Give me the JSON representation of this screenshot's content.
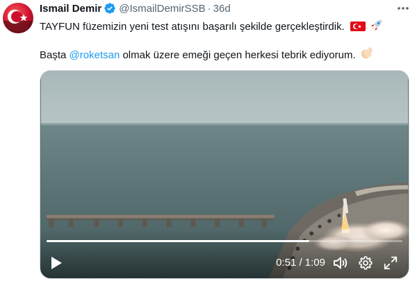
{
  "tweet": {
    "author_name": "Ismail Demir",
    "author_handle": "@IsmailDemirSSB",
    "separator": "·",
    "timestamp": "36d",
    "line1": "TAYFUN füzemizin yeni test atışını başarılı şekilde gerçekleştirdik.",
    "line2_before": "Başta ",
    "mention": "@roketsan",
    "line2_after": " olmak üzere emeği geçen herkesi tebrik ediyorum.",
    "emojis": [
      "turkey-flag",
      "rocket",
      "clapping-hands"
    ]
  },
  "video": {
    "current_time": "0:51",
    "time_separator": "/",
    "duration": "1:09",
    "time_display": "0:51 / 1:09",
    "progress_fraction": 0.739,
    "icons": [
      "play-icon",
      "volume-icon",
      "gear-icon",
      "fullscreen-icon"
    ]
  },
  "colors": {
    "accent": "#1d9bf0",
    "secondary_text": "#536471",
    "primary_text": "#0f1419",
    "flag_red": "#e30a17"
  }
}
